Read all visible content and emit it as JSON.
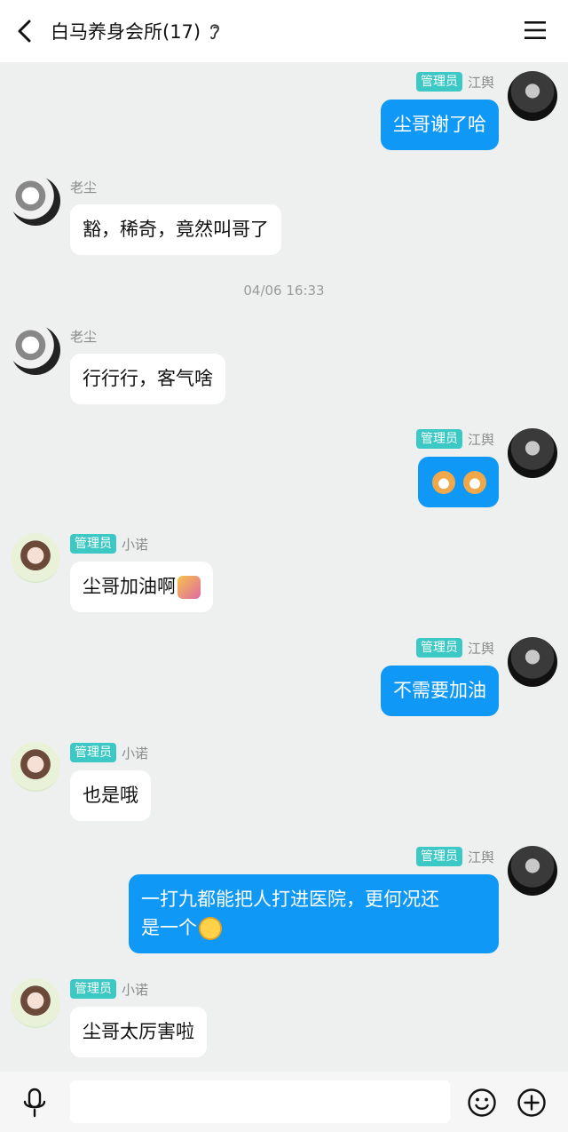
{
  "header": {
    "title": "白马养身会所(17)",
    "back_icon": "chevron-left-icon",
    "ear_icon": "ear-icon",
    "menu_icon": "hamburger-menu-icon"
  },
  "timestamp": "04/06 16:33",
  "messages": [
    {
      "side": "right",
      "badge": "管理员",
      "name": "江舆",
      "text": "尘哥谢了哈"
    },
    {
      "side": "left",
      "badge": "",
      "name": "老尘",
      "text": "豁，稀奇，竟然叫哥了"
    },
    {
      "side": "left",
      "badge": "",
      "name": "老尘",
      "text": "行行行，客气啥"
    },
    {
      "side": "right",
      "badge": "管理员",
      "name": "江舆",
      "text": "",
      "emoji": [
        "shiba-dog-emoji",
        "shiba-dog-emoji"
      ]
    },
    {
      "side": "left",
      "badge": "管理员",
      "name": "小诺",
      "text": "尘哥加油啊",
      "emoji": [
        "cheering-emoji"
      ]
    },
    {
      "side": "right",
      "badge": "管理员",
      "name": "江舆",
      "text": "不需要加油"
    },
    {
      "side": "left",
      "badge": "管理员",
      "name": "小诺",
      "text": "也是哦"
    },
    {
      "side": "right",
      "badge": "管理员",
      "name": "江舆",
      "text_line1": "一打九都能把人打进医院，更何况还",
      "text_line2": "是一个",
      "emoji": [
        "smug-face-emoji"
      ]
    },
    {
      "side": "left",
      "badge": "管理员",
      "name": "小诺",
      "text": "尘哥太厉害啦"
    }
  ],
  "input_bar": {
    "placeholder": "",
    "mic_icon": "microphone-icon",
    "emoji_icon": "smiley-face-icon",
    "plus_icon": "plus-circle-icon"
  },
  "colors": {
    "accent_bubble": "#0f98f5",
    "badge": "#3cc8c4",
    "background": "#eef0ef"
  }
}
